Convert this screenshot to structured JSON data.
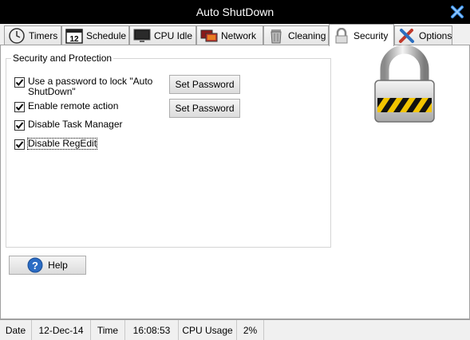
{
  "window": {
    "title": "Auto ShutDown"
  },
  "tabs": [
    {
      "label": "Timers",
      "icon": "clock-icon"
    },
    {
      "label": "Schedule",
      "icon": "calendar-icon",
      "icon_text": "12"
    },
    {
      "label": "CPU Idle",
      "icon": "monitor-icon"
    },
    {
      "label": "Network",
      "icon": "network-icon"
    },
    {
      "label": "Cleaning",
      "icon": "trash-icon"
    },
    {
      "label": "Security",
      "icon": "lock-icon",
      "active": true
    },
    {
      "label": "Options",
      "icon": "tools-icon"
    }
  ],
  "security": {
    "group_title": "Security and Protection",
    "options": [
      {
        "label": "Use a password to lock \"Auto ShutDown\"",
        "checked": true
      },
      {
        "label": "Enable remote action",
        "checked": true
      },
      {
        "label": "Disable Task Manager",
        "checked": true
      },
      {
        "label": "Disable RegEdit",
        "checked": true
      }
    ],
    "set_password_label_1": "Set Password",
    "set_password_label_2": "Set Password"
  },
  "help_label": "Help",
  "status": {
    "date_label": "Date",
    "date_value": "12-Dec-14",
    "time_label": "Time",
    "time_value": "16:08:53",
    "cpu_label": "CPU Usage",
    "cpu_value": "2%"
  },
  "colors": {
    "titlebar": "#000000",
    "close_icon": "#3a8ee6",
    "help_icon": "#2b6cc4",
    "lock_stripe_yellow": "#f2c400"
  }
}
